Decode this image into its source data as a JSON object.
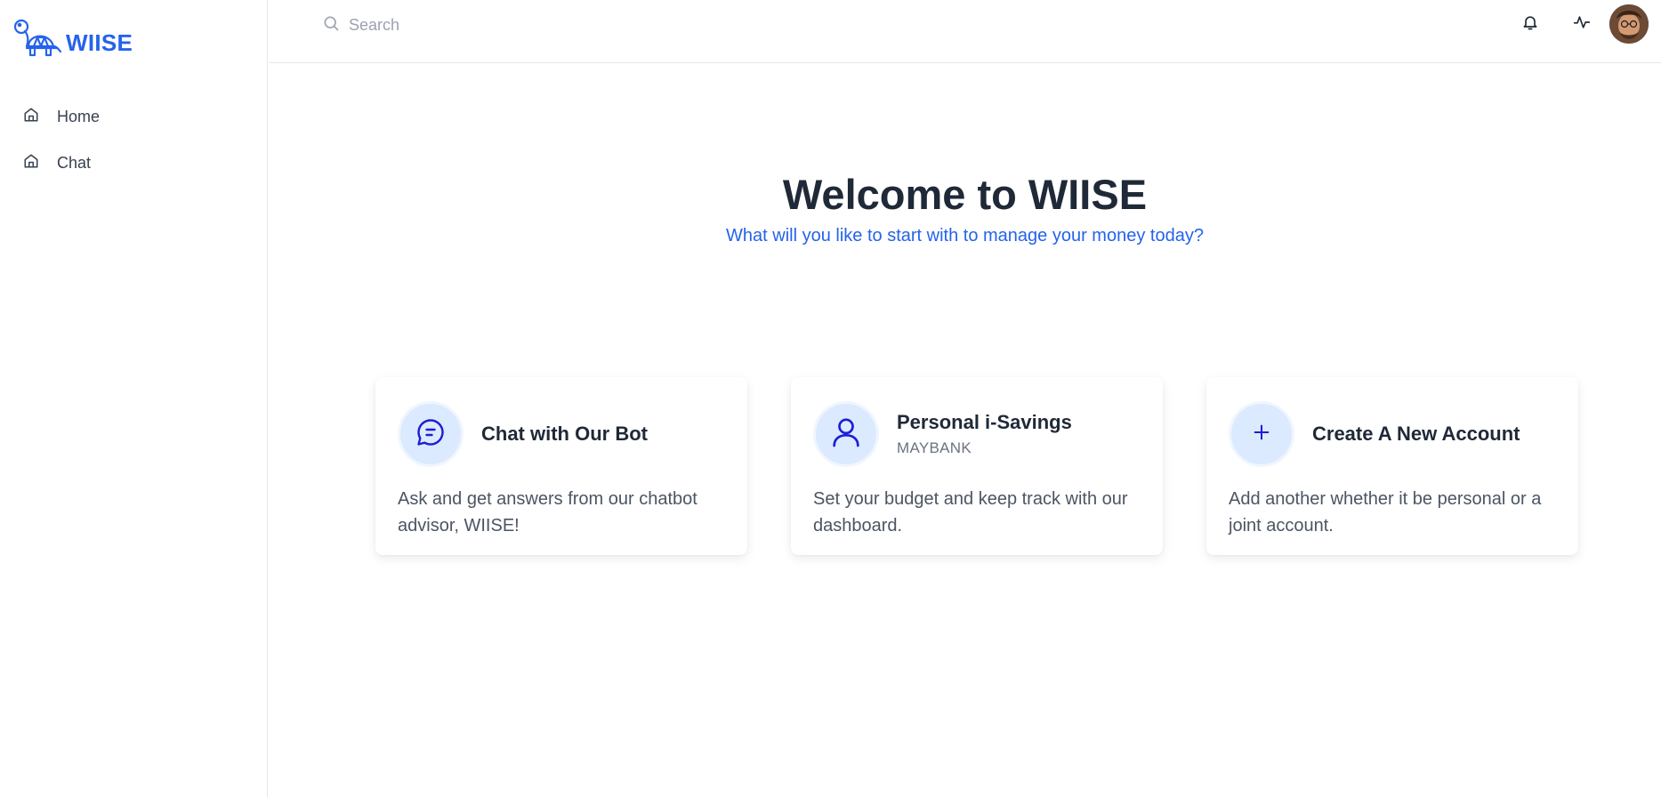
{
  "brand": {
    "name": "WIISE"
  },
  "sidebar": {
    "items": [
      {
        "label": "Home",
        "icon": "home-icon"
      },
      {
        "label": "Chat",
        "icon": "home-icon"
      }
    ]
  },
  "topbar": {
    "search_placeholder": "Search",
    "icons": [
      "bell-icon",
      "activity-icon",
      "avatar"
    ]
  },
  "hero": {
    "title": "Welcome to WIISE",
    "subtitle": "What will you like to start with to manage your money today?"
  },
  "cards": [
    {
      "title": "Chat with Our Bot",
      "subtitle": "",
      "description": "Ask and get answers from our chatbot advisor, WIISE!",
      "icon": "chat-icon"
    },
    {
      "title": "Personal i-Savings",
      "subtitle": "MAYBANK",
      "description": "Set your budget and keep track with our dashboard.",
      "icon": "user-icon"
    },
    {
      "title": "Create A New Account",
      "subtitle": "",
      "description": "Add another whether it be personal or a joint account.",
      "icon": "plus-icon"
    }
  ],
  "colors": {
    "accent": "#2563eb",
    "icon_bg": "#dbeafe",
    "icon_stroke": "#1d1dd6",
    "heading": "#1f2937"
  }
}
